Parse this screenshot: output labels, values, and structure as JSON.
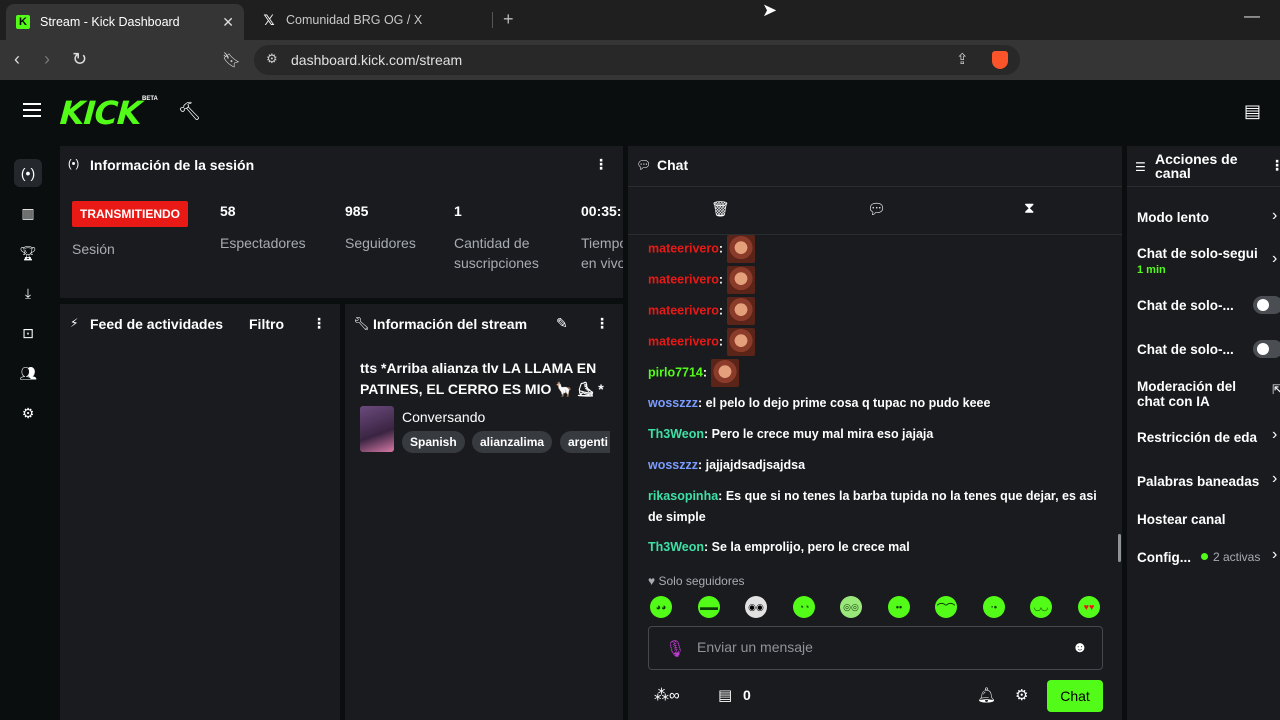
{
  "browser": {
    "tabs": [
      {
        "title": "Stream - Kick Dashboard",
        "active": true
      },
      {
        "title": "Comunidad BRG OG / X",
        "active": false
      }
    ],
    "url": "dashboard.kick.com/stream"
  },
  "header": {
    "logo": "KICK",
    "beta": "BETA"
  },
  "session": {
    "title": "Información de la sesión",
    "status": "TRANSMITIENDO",
    "status_label": "Sesión",
    "stats": [
      {
        "value": "58",
        "label": "Espectadores"
      },
      {
        "value": "985",
        "label": "Seguidores"
      },
      {
        "value": "1",
        "label": "Cantidad de suscripciones"
      },
      {
        "value": "00:35:",
        "label": "Tiempo en vivo"
      }
    ]
  },
  "activity_feed": {
    "title": "Feed de actividades",
    "filter": "Filtro"
  },
  "stream_info": {
    "title": "Información del stream",
    "stream_title": "tts *Arriba alianza tlv LA LLAMA EN PATINES, EL CERRO ES MIO 🦙 ⛸ *",
    "category": "Conversando",
    "tags": [
      "Spanish",
      "alianzalima",
      "argenti"
    ]
  },
  "chat": {
    "title": "Chat",
    "messages": [
      {
        "user": "mateerivero",
        "color": "#e91916",
        "text": "",
        "emote": true
      },
      {
        "user": "mateerivero",
        "color": "#e91916",
        "text": "",
        "emote": true
      },
      {
        "user": "mateerivero",
        "color": "#e91916",
        "text": "",
        "emote": true
      },
      {
        "user": "mateerivero",
        "color": "#e91916",
        "text": "",
        "emote": true
      },
      {
        "user": "pirlo7714",
        "color": "#53fc18",
        "text": "",
        "emote": true
      },
      {
        "user": "wosszzz",
        "color": "#7b9cff",
        "text": "el pelo lo dejo prime cosa q tupac no pudo keee",
        "emote": false
      },
      {
        "user": "Th3Weon",
        "color": "#3ee0a5",
        "text": "Pero le crece muy mal mira eso jajaja",
        "emote": false
      },
      {
        "user": "wosszzz",
        "color": "#7b9cff",
        "text": "jajjajdsadjsajdsa",
        "emote": false
      },
      {
        "user": "rikasopinha",
        "color": "#3ee0a5",
        "text": "Es que si no tenes la barba tupida no la tenes que dejar, es asi de simple",
        "emote": false
      },
      {
        "user": "Th3Weon",
        "color": "#3ee0a5",
        "text": "Se la emprolijo, pero le crece mal",
        "emote": false
      }
    ],
    "followers_only": "Solo seguidores",
    "input_placeholder": "Enviar un mensaje",
    "points": "0",
    "send_label": "Chat"
  },
  "channel_actions": {
    "title": "Acciones de canal",
    "items": [
      {
        "label": "Modo lento"
      },
      {
        "label": "Chat de solo-segui",
        "sub": "1 min"
      },
      {
        "label": "Chat de solo-..."
      },
      {
        "label": "Chat de solo-..."
      },
      {
        "label": "Moderación del chat con IA"
      },
      {
        "label": "Restricción de eda"
      },
      {
        "label": "Palabras baneadas"
      },
      {
        "label": "Hostear canal"
      },
      {
        "label": "Config...",
        "sub": "2 activas"
      }
    ]
  },
  "colors": {
    "brand": "#53fc18",
    "live": "#e91916",
    "panel": "#191b1f"
  }
}
